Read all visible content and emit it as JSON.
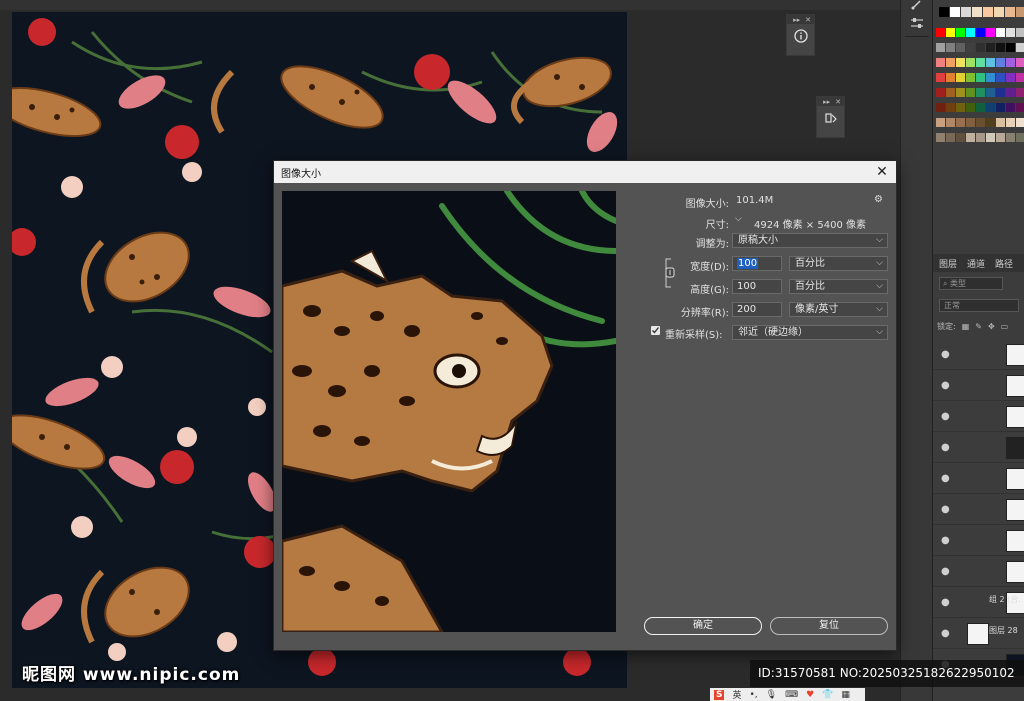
{
  "dialog": {
    "title": "图像大小",
    "image_size_label": "图像大小:",
    "image_size_value": "101.4M",
    "dimensions_label": "尺寸:",
    "dimensions_value": "4924 像素 × 5400 像素",
    "fit_to_label": "调整为:",
    "fit_to_value": "原稿大小",
    "width_label": "宽度(D):",
    "width_value": "100",
    "width_unit": "百分比",
    "height_label": "高度(G):",
    "height_value": "100",
    "height_unit": "百分比",
    "resolution_label": "分辨率(R):",
    "resolution_value": "200",
    "resolution_unit": "像素/英寸",
    "resample_label": "重新采样(S):",
    "resample_checked": true,
    "resample_value": "邻近（硬边缘）",
    "ok_label": "确定",
    "reset_label": "复位",
    "close_glyph": "✕",
    "gear_glyph": "⚙"
  },
  "layers_panel": {
    "tabs": [
      "图层",
      "通道",
      "路径"
    ],
    "search_placeholder": "类型",
    "blend_mode": "正常",
    "lock_label": "锁定:",
    "group_label": "组 2 (合...",
    "bottom_layer_label": "图层 28"
  },
  "watermarks": {
    "left": "昵图网 www.nipic.com",
    "right": "ID:31570581 NO:20250325182622950102"
  },
  "ime_bar": {
    "lang": "英"
  },
  "colors": {
    "accent": "#1f5fbf",
    "dialog_bg": "#535353",
    "canvas_bg": "#0d1520"
  }
}
